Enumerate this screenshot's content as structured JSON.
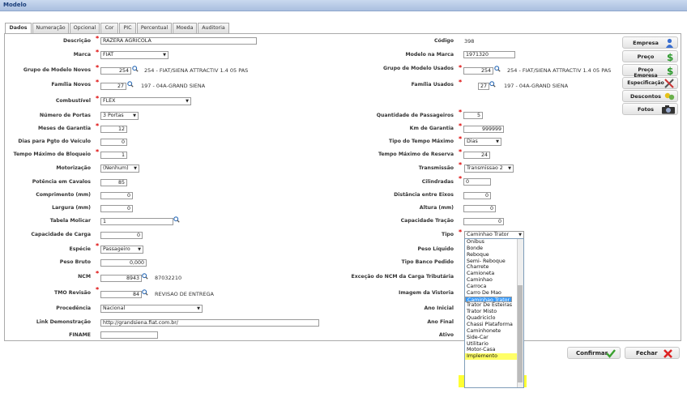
{
  "window": {
    "title": "Modelo"
  },
  "tabs": [
    "Dados",
    "Numeração",
    "Opcional",
    "Cor",
    "PIC",
    "Percentual",
    "Moeda",
    "Auditoria"
  ],
  "left": {
    "descricao": {
      "label": "Descrição",
      "value": "RAZERA AGRICOLA"
    },
    "marca": {
      "label": "Marca",
      "value": "FIAT"
    },
    "grupo_novos": {
      "label": "Grupo de Modelo Novos",
      "value": "254",
      "desc": "254 - FIAT/SIENA ATTRACTIV 1.4 05 PAS"
    },
    "familia_novos": {
      "label": "Família Novos",
      "value": "27",
      "desc": "197 - 04A-GRAND SIENA"
    },
    "combustivel": {
      "label": "Combustível",
      "value": "FLEX"
    },
    "portas": {
      "label": "Número de Portas",
      "value": "3 Portas"
    },
    "garantia": {
      "label": "Meses de Garantia",
      "value": "12"
    },
    "dias_pgto": {
      "label": "Dias para Pgto do Veículo",
      "value": "0"
    },
    "bloqueio": {
      "label": "Tempo Máximo de Bloqueio",
      "value": "1"
    },
    "motorizacao": {
      "label": "Motorização",
      "value": "(Nenhum)"
    },
    "potencia": {
      "label": "Potência em Cavalos",
      "value": "85"
    },
    "comprimento": {
      "label": "Comprimento (mm)",
      "value": "0"
    },
    "largura": {
      "label": "Largura (mm)",
      "value": "0"
    },
    "molicar": {
      "label": "Tabela Molicar",
      "value": "1"
    },
    "carga": {
      "label": "Capacidade de Carga",
      "value": "0"
    },
    "especie": {
      "label": "Espécie",
      "value": "Passageiro"
    },
    "peso_bruto": {
      "label": "Peso Bruto",
      "value": "0,000"
    },
    "ncm": {
      "label": "NCM",
      "value": "8943",
      "desc": "87032210"
    },
    "tmo": {
      "label": "TMO Revisão",
      "value": "84",
      "desc": "REVISAO DE ENTREGA"
    },
    "procedencia": {
      "label": "Procedência",
      "value": "Nacional"
    },
    "link": {
      "label": "Link Demonstração",
      "value": "http://grandsiena.fiat.com.br/"
    },
    "finame": {
      "label": "FINAME",
      "value": ""
    }
  },
  "right": {
    "codigo": {
      "label": "Código",
      "value": "398"
    },
    "modelo_marca": {
      "label": "Modelo na Marca",
      "value": "1971320"
    },
    "grupo_usados": {
      "label": "Grupo de Modelo Usados",
      "value": "254",
      "desc": "254 - FIAT/SIENA ATTRACTIV 1.4 05 PAS"
    },
    "familia_usados": {
      "label": "Família Usados",
      "value": "27",
      "desc": "197 - 04A-GRAND SIENA"
    },
    "passageiros": {
      "label": "Quantidade de Passageiros",
      "value": "5"
    },
    "km_garantia": {
      "label": "Km de Garantia",
      "value": "999999"
    },
    "tipo_tempo": {
      "label": "Tipo do Tempo Máximo",
      "value": "Dias"
    },
    "reserva": {
      "label": "Tempo Máximo de Reserva",
      "value": "24"
    },
    "transmissao": {
      "label": "Transmissão",
      "value": "Transmissao 2"
    },
    "cilindradas": {
      "label": "Cilindradas",
      "value": "0"
    },
    "eixos": {
      "label": "Distância entre Eixos",
      "value": "0"
    },
    "altura": {
      "label": "Altura (mm)",
      "value": "0"
    },
    "tracao": {
      "label": "Capacidade Tração",
      "value": "0"
    },
    "tipo": {
      "label": "Tipo",
      "value": "Caminhao Trator"
    },
    "peso_liquido": {
      "label": "Peso Líquido"
    },
    "tipo_pedido": {
      "label": "Tipo Banco Pedido"
    },
    "excecao_ncm": {
      "label": "Exceção do NCM da Carga Tributária"
    },
    "imagem_vistoria": {
      "label": "Imagem da Vistoria"
    },
    "ano_inicial": {
      "label": "Ano Inicial"
    },
    "ano_final": {
      "label": "Ano Final"
    },
    "ativo": {
      "label": "Ativo"
    }
  },
  "tipo_options": [
    "Onibus",
    "Bonde",
    "Reboque",
    "Semi- Reboque",
    "Charrete",
    "Camioneta",
    "Caminhao",
    "Carroca",
    "Carro De Mao",
    "Caminhao Trator",
    "Trator De Rodas",
    "Trator De Esteiras",
    "Trator Misto",
    "Quadriciclo",
    "Chassi Plataforma",
    "Caminhonete",
    "Side-Car",
    "Utilitario",
    "Motor-Casa",
    "Implemento"
  ],
  "side_buttons": {
    "empresa": "Empresa",
    "preco": "Preço",
    "preco_empresa": "Preço Empresa",
    "especificacao": "Especificação",
    "descontos": "Descontos",
    "fotos": "Fotos"
  },
  "actions": {
    "confirmar": "Confirmar",
    "fechar": "Fechar"
  },
  "colors": {
    "accent": "#3399ff",
    "required": "#dd0000",
    "highlight": "#ffff33",
    "titlebar": "#aabfdf"
  }
}
